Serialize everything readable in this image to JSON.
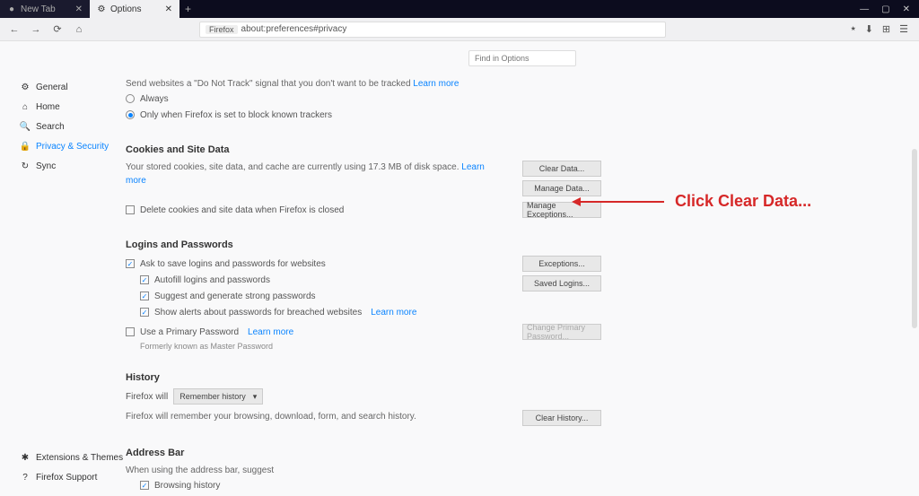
{
  "window": {
    "tabs": [
      {
        "label": "New Tab",
        "active": false,
        "icon": "firefox-icon"
      },
      {
        "label": "Options",
        "active": true,
        "icon": "gear-icon"
      }
    ],
    "controls": {
      "min": "—",
      "max": "▢",
      "close": "✕"
    }
  },
  "toolbar": {
    "back": "←",
    "forward": "→",
    "reload": "⟳",
    "home": "⌂",
    "url_badge": "Firefox",
    "url": "about:preferences#privacy",
    "right_icons": [
      "⭑",
      "⬇",
      "⊞",
      "☰"
    ]
  },
  "sidebar": {
    "items": [
      {
        "icon": "gear-icon",
        "label": "General"
      },
      {
        "icon": "home-icon",
        "label": "Home"
      },
      {
        "icon": "search-icon",
        "label": "Search"
      },
      {
        "icon": "lock-icon",
        "label": "Privacy & Security",
        "active": true
      },
      {
        "icon": "sync-icon",
        "label": "Sync"
      }
    ],
    "bottom": [
      {
        "icon": "puzzle-icon",
        "label": "Extensions & Themes"
      },
      {
        "icon": "help-icon",
        "label": "Firefox Support"
      }
    ]
  },
  "search": {
    "placeholder": "Find in Options",
    "icon": "🔍"
  },
  "dnt": {
    "desc": "Send websites a \"Do Not Track\" signal that you don't want to be tracked",
    "learn": "Learn more",
    "opt_always": "Always",
    "opt_only": "Only when Firefox is set to block known trackers"
  },
  "cookies": {
    "title": "Cookies and Site Data",
    "desc": "Your stored cookies, site data, and cache are currently using 17.3 MB of disk space.",
    "learn": "Learn more",
    "btn_clear": "Clear Data...",
    "btn_manage": "Manage Data...",
    "btn_exceptions": "Manage Exceptions...",
    "chk_delete": "Delete cookies and site data when Firefox is closed"
  },
  "logins": {
    "title": "Logins and Passwords",
    "chk_ask": "Ask to save logins and passwords for websites",
    "chk_autofill": "Autofill logins and passwords",
    "chk_suggest": "Suggest and generate strong passwords",
    "chk_alerts": "Show alerts about passwords for breached websites",
    "learn": "Learn more",
    "chk_primary": "Use a Primary Password",
    "learn2": "Learn more",
    "note": "Formerly known as Master Password",
    "btn_exceptions": "Exceptions...",
    "btn_saved": "Saved Logins...",
    "btn_change": "Change Primary Password..."
  },
  "history": {
    "title": "History",
    "label": "Firefox will",
    "select_value": "Remember history",
    "desc": "Firefox will remember your browsing, download, form, and search history.",
    "btn_clear": "Clear History..."
  },
  "address": {
    "title": "Address Bar",
    "desc": "When using the address bar, suggest",
    "chk_history": "Browsing history"
  },
  "annotation": {
    "text": "Click Clear Data..."
  }
}
